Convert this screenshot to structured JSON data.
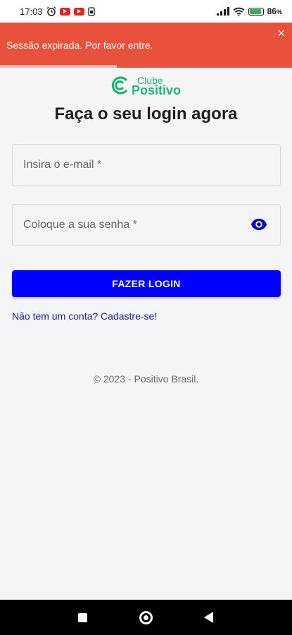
{
  "status_bar": {
    "time": "17:03",
    "battery": "86",
    "battery_unit": "%",
    "icons": [
      "alarm-icon",
      "youtube-icon",
      "youtube-icon",
      "sim-icon",
      "signal-icon",
      "wifi-icon",
      "battery-icon"
    ]
  },
  "toast": {
    "message": "Sessão expirada. Por favor entre.",
    "close": "×",
    "progress": 0.4,
    "color": "#e8513c"
  },
  "logo": {
    "line1": "Clube",
    "line2": "Positivo",
    "color": "#21b573"
  },
  "page": {
    "title": "Faça o seu login agora"
  },
  "form": {
    "email_placeholder": "Insira o e-mail *",
    "password_placeholder": "Coloque a sua senha *",
    "login_label": "FAZER LOGIN",
    "button_color": "#0000ff"
  },
  "signup": {
    "text": "Não tem um conta? Cadastre-se!"
  },
  "footer": {
    "text": "© 2023 - Positivo Brasil."
  }
}
